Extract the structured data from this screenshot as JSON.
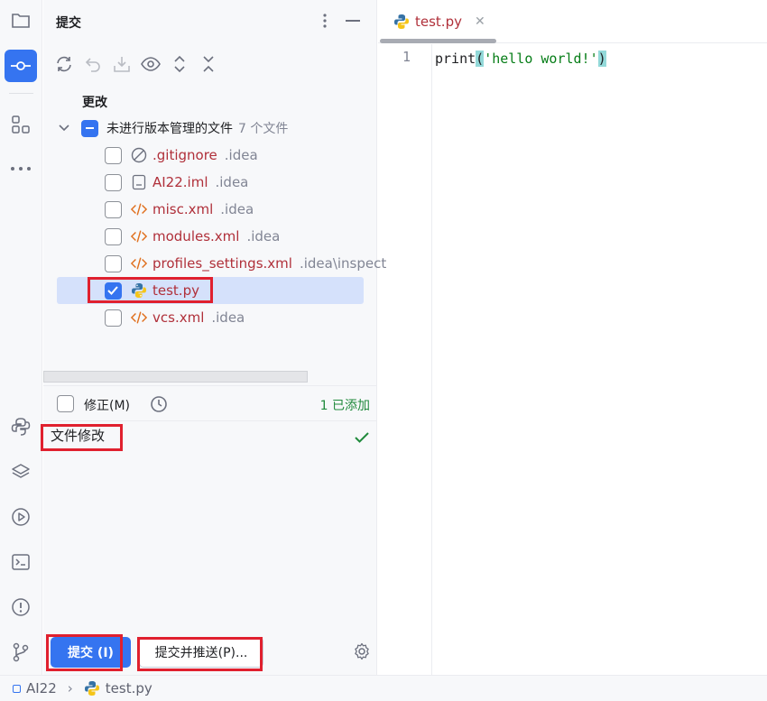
{
  "panel": {
    "title": "提交",
    "changes_label": "更改",
    "group": {
      "name": "未进行版本管理的文件",
      "count": "7 个文件"
    },
    "files": [
      {
        "name": ".gitignore",
        "dir": ".idea",
        "icon": "gitignore-icon",
        "checked": false
      },
      {
        "name": "AI22.iml",
        "dir": ".idea",
        "icon": "iml-file-icon",
        "checked": false
      },
      {
        "name": "misc.xml",
        "dir": ".idea",
        "icon": "xml-file-icon",
        "checked": false
      },
      {
        "name": "modules.xml",
        "dir": ".idea",
        "icon": "xml-file-icon",
        "checked": false
      },
      {
        "name": "profiles_settings.xml",
        "dir": ".idea\\inspect",
        "icon": "xml-file-icon",
        "checked": false
      },
      {
        "name": "test.py",
        "dir": "",
        "icon": "python-file-icon",
        "checked": true
      },
      {
        "name": "vcs.xml",
        "dir": ".idea",
        "icon": "xml-file-icon",
        "checked": false
      }
    ],
    "amend_label": "修正(M)",
    "added_status": "1 已添加",
    "commit_message": "文件修改",
    "commit_button": "提交 (I)",
    "commit_push_button": "提交并推送(P)..."
  },
  "editor": {
    "tab_name": "test.py",
    "line_number": "1",
    "code": {
      "func": "print",
      "open": "(",
      "string": "'hello world!'",
      "close": ")"
    }
  },
  "statusbar": {
    "project": "AI22",
    "file": "test.py"
  },
  "colors": {
    "accent": "#3574f0",
    "highlight_box": "#e0202e",
    "added_green": "#208a3c",
    "untracked_file": "#b0303a"
  }
}
